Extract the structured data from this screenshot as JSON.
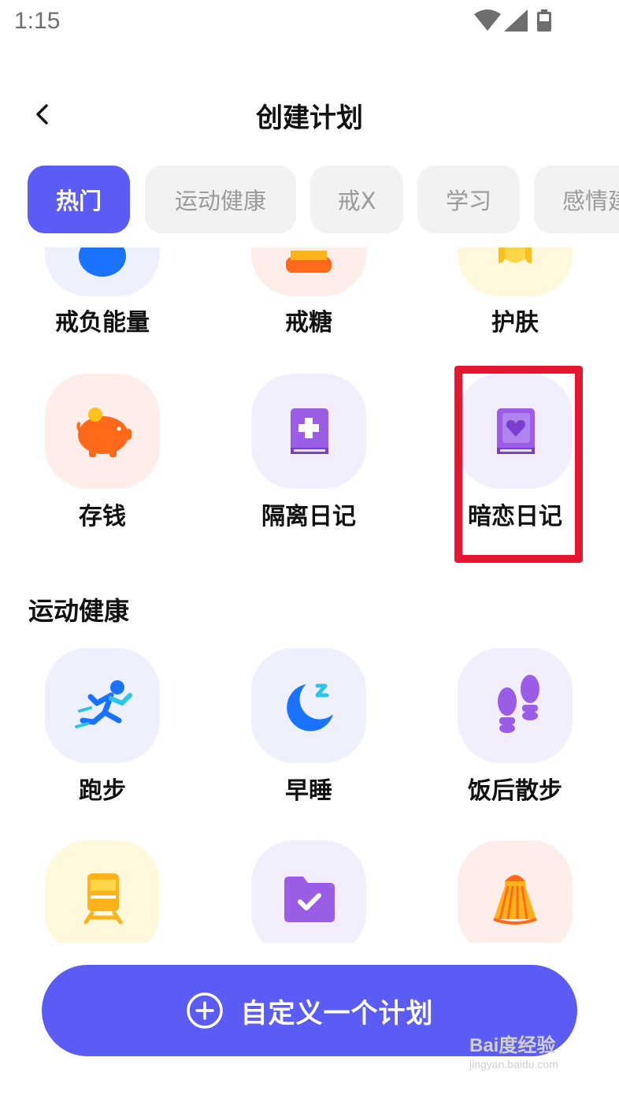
{
  "status_bar": {
    "time": "1:15"
  },
  "header": {
    "title": "创建计划"
  },
  "tabs": [
    {
      "label": "热门",
      "active": true
    },
    {
      "label": "运动健康",
      "active": false
    },
    {
      "label": "戒X",
      "active": false
    },
    {
      "label": "学习",
      "active": false
    },
    {
      "label": "感情建",
      "active": false
    }
  ],
  "hot_items": [
    {
      "label": "戒负能量",
      "icon": "negative-energy-icon"
    },
    {
      "label": "戒糖",
      "icon": "candy-icon"
    },
    {
      "label": "护肤",
      "icon": "skincare-icon"
    },
    {
      "label": "存钱",
      "icon": "piggy-bank-icon"
    },
    {
      "label": "隔离日记",
      "icon": "medical-diary-icon"
    },
    {
      "label": "暗恋日记",
      "icon": "heart-diary-icon"
    }
  ],
  "section_sports": {
    "title": "运动健康"
  },
  "sports_items": [
    {
      "label": "跑步",
      "icon": "runner-icon"
    },
    {
      "label": "早睡",
      "icon": "moon-sleep-icon"
    },
    {
      "label": "饭后散步",
      "icon": "footprints-icon"
    },
    {
      "label": "",
      "icon": "train-icon"
    },
    {
      "label": "",
      "icon": "folder-check-icon"
    },
    {
      "label": "",
      "icon": "shuttlecock-icon"
    }
  ],
  "custom_button": {
    "label": "自定义一个计划"
  },
  "watermark": {
    "brand": "Bai度经验",
    "url": "jingyan.baidu.com"
  },
  "colors": {
    "accent": "#5b5bf5",
    "highlight": "#e5162f",
    "tab_inactive_bg": "#f2f2f2",
    "tab_inactive_text": "#9a9a9a"
  }
}
